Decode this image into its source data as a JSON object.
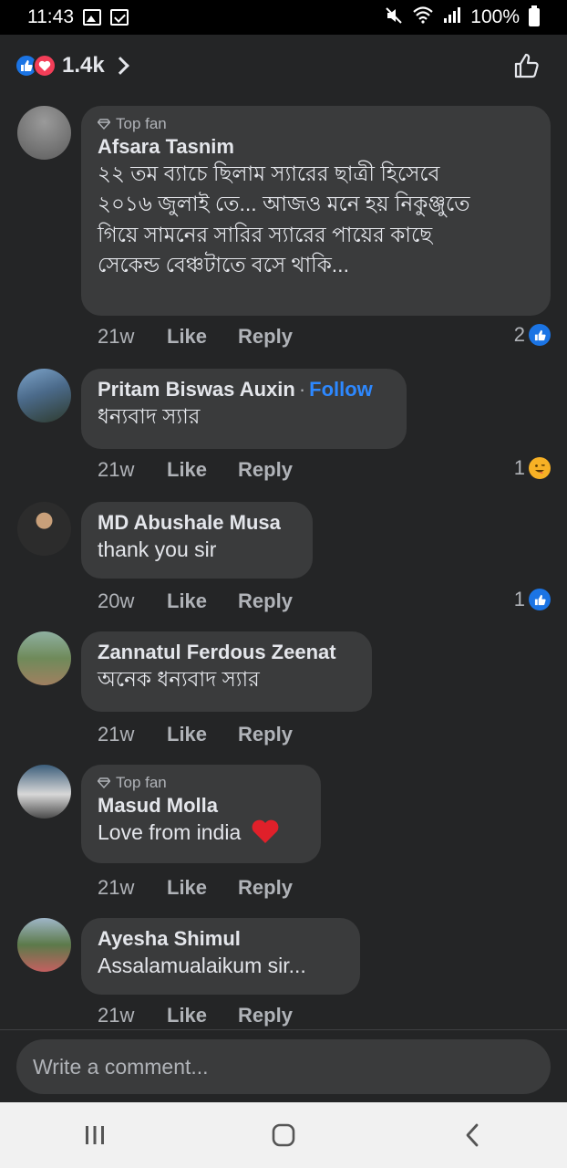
{
  "status_bar": {
    "time": "11:43",
    "battery": "100%"
  },
  "header": {
    "reaction_count": "1.4k"
  },
  "comments": [
    {
      "top_fan": "Top fan",
      "name": "Afsara Tasnim",
      "lines": [
        "২২ তম ব্যাচে ছিলাম স্যারের ছাত্রী হিসেবে",
        "২০১৬ জুলাই তে...  আজও মনে হয়  নিকুঞ্জুতে",
        "গিয়ে সামনের সারির স্যারের পায়ের কাছে",
        "সেকেন্ড বেঞ্চটাতে বসে থাকি..."
      ],
      "time": "21w",
      "like": "Like",
      "reply": "Reply",
      "reaction_count": "2",
      "reaction_icon": "like-icon"
    },
    {
      "name": "Pritam Biswas Auxin",
      "follow": "Follow",
      "separator": "·",
      "text": "ধন্যবাদ স্যার",
      "time": "21w",
      "like": "Like",
      "reply": "Reply",
      "reaction_count": "1",
      "reaction_icon": "haha-icon"
    },
    {
      "name": "MD Abushale Musa",
      "text": "thank you sir",
      "time": "20w",
      "like": "Like",
      "reply": "Reply",
      "reaction_count": "1",
      "reaction_icon": "like-icon"
    },
    {
      "name": "Zannatul Ferdous Zeenat",
      "text": "অনেক ধন্যবাদ স্যার",
      "time": "21w",
      "like": "Like",
      "reply": "Reply"
    },
    {
      "top_fan": "Top fan",
      "name": "Masud Molla",
      "text": "Love from india",
      "emoji": "❤️",
      "time": "21w",
      "like": "Like",
      "reply": "Reply"
    },
    {
      "name": "Ayesha Shimul",
      "text": "Assalamualaikum sir...",
      "time": "21w",
      "like": "Like",
      "reply": "Reply"
    }
  ],
  "composer": {
    "placeholder": "Write a comment..."
  },
  "colors": {
    "background": "#242526",
    "bubble": "#3a3b3c",
    "accent": "#2d88ff",
    "love": "#f33e58"
  }
}
